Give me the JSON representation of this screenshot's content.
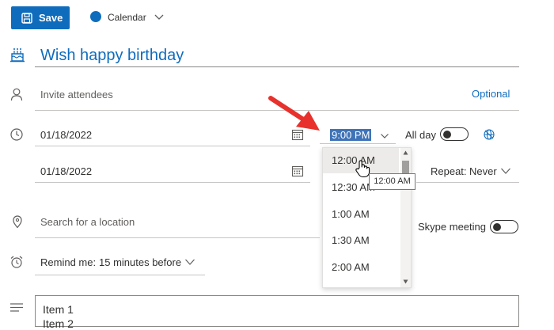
{
  "toolbar": {
    "save_label": "Save",
    "calendar_label": "Calendar"
  },
  "event": {
    "title": "Wish happy birthday"
  },
  "attendees": {
    "placeholder": "Invite attendees",
    "optional_label": "Optional"
  },
  "start": {
    "date": "01/18/2022",
    "time": "9:00 PM",
    "all_day_label": "All day"
  },
  "end": {
    "date": "01/18/2022",
    "repeat_label": "Repeat:",
    "repeat_value": "Never"
  },
  "time_dropdown": {
    "options": [
      "12:00 AM",
      "12:30 AM",
      "1:00 AM",
      "1:30 AM",
      "2:00 AM"
    ],
    "hovered": "12:00 AM",
    "tooltip": "12:00 AM"
  },
  "location": {
    "placeholder": "Search for a location",
    "skype_label": "Skype meeting"
  },
  "reminder": {
    "label": "Remind me:",
    "value": "15 minutes before"
  },
  "notes": {
    "lines": [
      "Item 1",
      "Item 2"
    ]
  },
  "colors": {
    "accent": "#0f6cbd",
    "arrow": "#e8312c",
    "selection": "#3f73b8"
  }
}
